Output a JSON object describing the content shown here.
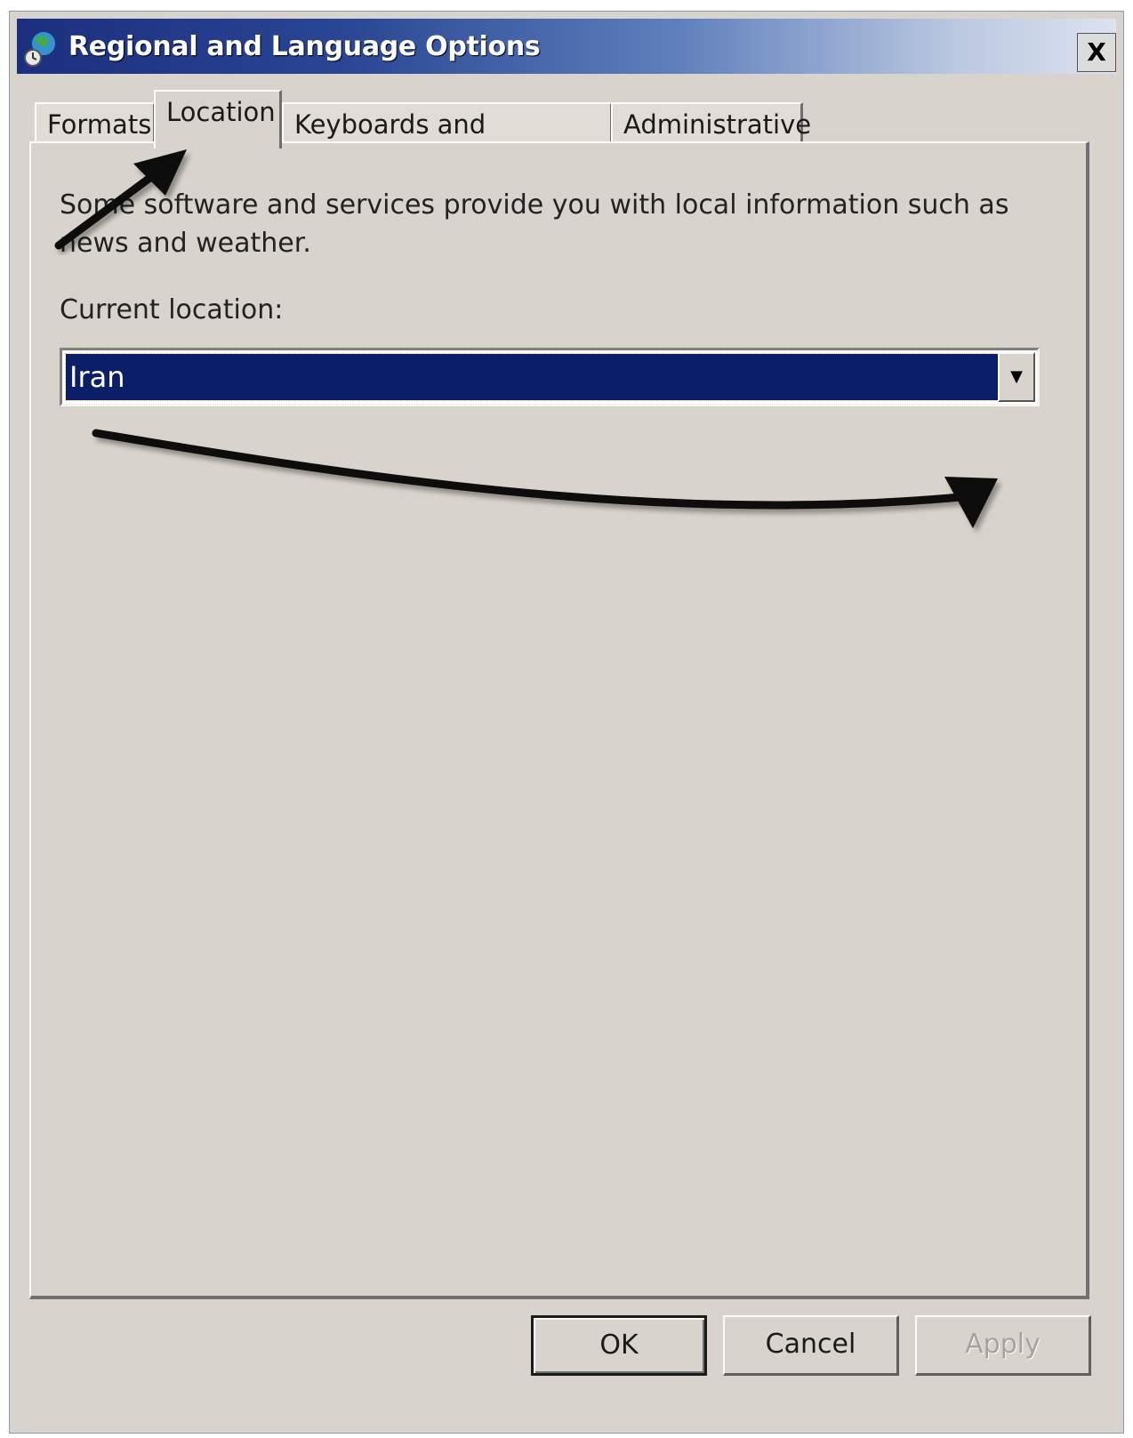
{
  "window": {
    "title": "Regional and Language Options",
    "close_label": "X"
  },
  "tabs": [
    {
      "label": "Formats",
      "active": false
    },
    {
      "label": "Location",
      "active": true
    },
    {
      "label": "Keyboards and Languages",
      "active": false
    },
    {
      "label": "Administrative",
      "active": false
    }
  ],
  "location": {
    "description": "Some software and services provide you with local information such as news and weather.",
    "current_label": "Current location:",
    "current_value": "Iran"
  },
  "buttons": {
    "ok": "OK",
    "cancel": "Cancel",
    "apply": "Apply"
  },
  "colors": {
    "selection": "#0b1f68",
    "dialog_bg": "#d8d4cd"
  },
  "icons": {
    "app": "globe-icon",
    "dropdown": "chevron-down-icon"
  }
}
